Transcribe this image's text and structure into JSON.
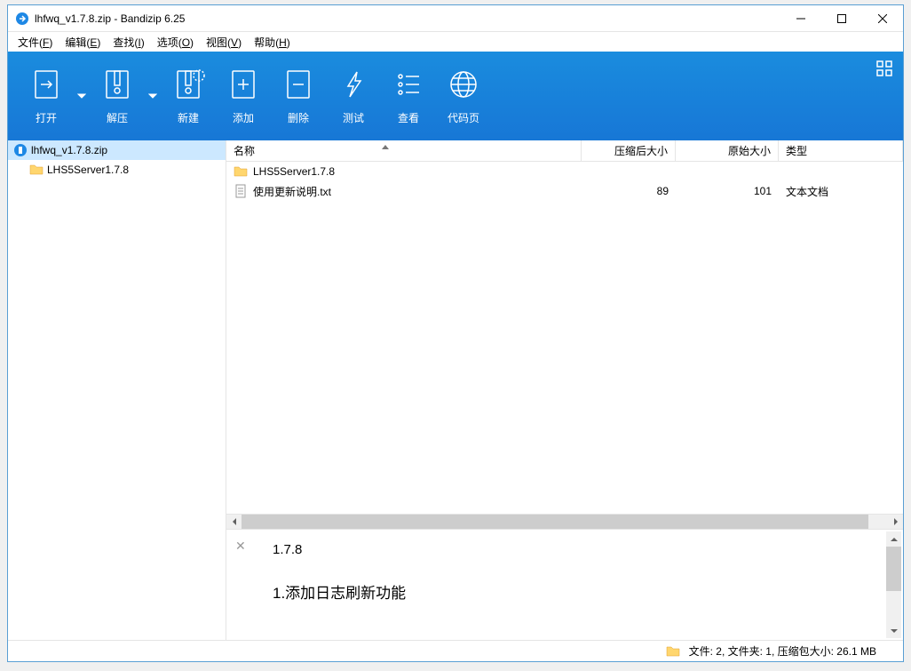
{
  "window": {
    "title": "lhfwq_v1.7.8.zip - Bandizip 6.25"
  },
  "menu": {
    "file": "文件(F)",
    "edit": "编辑(E)",
    "find": "查找(I)",
    "options": "选项(O)",
    "view": "视图(V)",
    "help": "帮助(H)"
  },
  "toolbar": {
    "open": "打开",
    "extract": "解压",
    "new": "新建",
    "add": "添加",
    "delete": "删除",
    "test": "测试",
    "view": "查看",
    "codepage": "代码页"
  },
  "tree": {
    "root": "lhfwq_v1.7.8.zip",
    "child": "LHS5Server1.7.8"
  },
  "columns": {
    "name": "名称",
    "compressed": "压缩后大小",
    "original": "原始大小",
    "type": "类型"
  },
  "files": [
    {
      "name": "LHS5Server1.7.8",
      "compressed": "",
      "original": "",
      "type": "",
      "kind": "folder"
    },
    {
      "name": "使用更新说明.txt",
      "compressed": "89",
      "original": "101",
      "type": "文本文档",
      "kind": "text"
    }
  ],
  "preview": {
    "version": "1.7.8",
    "line": "1.添加日志刷新功能"
  },
  "status": {
    "text": "文件: 2, 文件夹: 1, 压缩包大小: 26.1 MB"
  }
}
